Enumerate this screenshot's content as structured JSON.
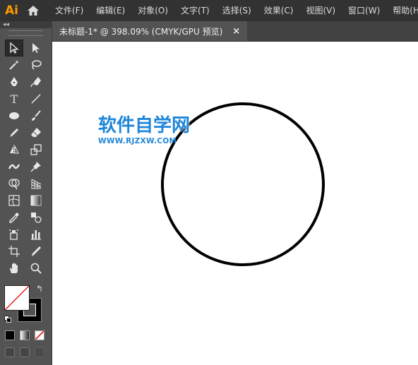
{
  "app": {
    "logo_text": "Ai",
    "logo_color": "#ff9a00"
  },
  "menu": [
    {
      "label": "文件(F)"
    },
    {
      "label": "编辑(E)"
    },
    {
      "label": "对象(O)"
    },
    {
      "label": "文字(T)"
    },
    {
      "label": "选择(S)"
    },
    {
      "label": "效果(C)"
    },
    {
      "label": "视图(V)"
    },
    {
      "label": "窗口(W)"
    },
    {
      "label": "帮助(H)"
    }
  ],
  "toolbar": {
    "collapse_label": "◂◂",
    "type_tool_glyph": "T",
    "tools": [
      [
        "selection-tool",
        "direct-selection-tool"
      ],
      [
        "magic-wand-tool",
        "lasso-tool"
      ],
      [
        "pen-tool",
        "curvature-tool"
      ],
      [
        "type-tool",
        "line-segment-tool"
      ],
      [
        "ellipse-tool",
        "paintbrush-tool"
      ],
      [
        "shaper-tool",
        "eraser-tool"
      ],
      [
        "reflect-tool",
        "scale-tool"
      ],
      [
        "width-tool",
        "puppet-warp-tool"
      ],
      [
        "shape-builder-tool",
        "perspective-grid-tool"
      ],
      [
        "mesh-tool",
        "gradient-tool"
      ],
      [
        "eyedropper-tool",
        "blend-tool"
      ],
      [
        "symbol-sprayer-tool",
        "column-graph-tool"
      ],
      [
        "artboard-tool",
        "slice-tool"
      ],
      [
        "hand-tool",
        "zoom-tool"
      ]
    ],
    "fill": "none",
    "stroke": "#000000",
    "swap_glyph": "↰"
  },
  "document": {
    "tab_title": "未标题-1* @ 398.09% (CMYK/GPU 预览)",
    "close_glyph": "×"
  },
  "canvas": {
    "shape": "circle",
    "stroke_color": "#000000",
    "fill_color": "none"
  },
  "watermark": {
    "title": "软件自学网",
    "url": "WWW.RJZXW.COM",
    "color": "#1e86d9"
  }
}
